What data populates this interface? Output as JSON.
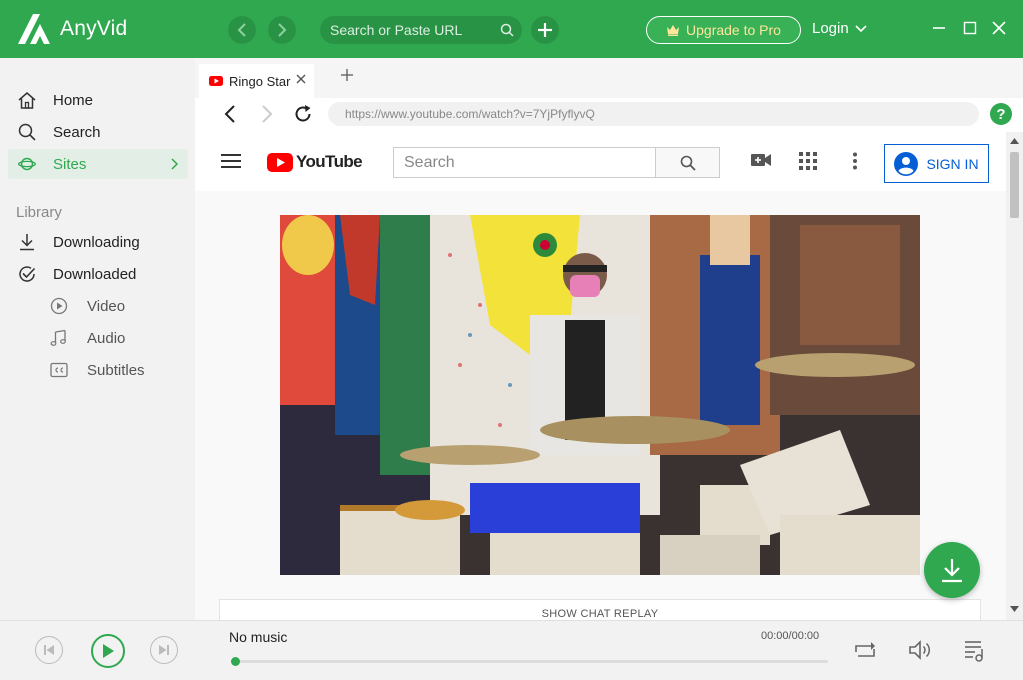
{
  "app": {
    "name": "AnyVid",
    "brand_color": "#2fa84f"
  },
  "topbar": {
    "search_placeholder": "Search or Paste URL",
    "upgrade_label": "Upgrade to Pro",
    "login_label": "Login"
  },
  "sidebar": {
    "items": [
      {
        "label": "Home",
        "icon": "home-icon"
      },
      {
        "label": "Search",
        "icon": "search-icon"
      },
      {
        "label": "Sites",
        "icon": "planet-icon",
        "active": true
      }
    ],
    "library_label": "Library",
    "library_items": [
      {
        "label": "Downloading",
        "icon": "download-arrow-icon"
      },
      {
        "label": "Downloaded",
        "icon": "check-circle-icon"
      }
    ],
    "sub_items": [
      {
        "label": "Video",
        "icon": "play-circle-icon"
      },
      {
        "label": "Audio",
        "icon": "music-note-icon"
      },
      {
        "label": "Subtitles",
        "icon": "cc-icon"
      }
    ]
  },
  "browser": {
    "tab_title": "Ringo Star",
    "url": "https://www.youtube.com/watch?v=7YjPfyflyvQ"
  },
  "youtube": {
    "logo_text": "YouTube",
    "search_placeholder": "Search",
    "signin_label": "SIGN IN",
    "chat_replay_label": "SHOW CHAT REPLAY"
  },
  "player": {
    "title": "No music",
    "time": "00:00/00:00",
    "progress": 0
  }
}
